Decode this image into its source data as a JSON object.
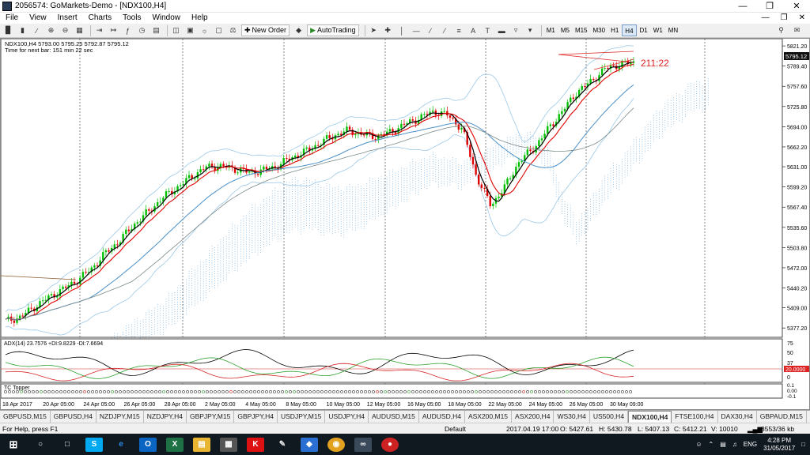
{
  "window": {
    "title": "2056574: GoMarkets-Demo - [NDX100,H4]"
  },
  "menu": [
    "File",
    "View",
    "Insert",
    "Charts",
    "Tools",
    "Window",
    "Help"
  ],
  "toolbar": {
    "new_order": "New Order",
    "auto_trading": "AutoTrading",
    "timeframes": [
      "M1",
      "M5",
      "M15",
      "M30",
      "H1",
      "H4",
      "D1",
      "W1",
      "MN"
    ],
    "selected_timeframe": "H4"
  },
  "chart": {
    "symbol_info": "NDX100,H4  5793.00 5795.25 5792.87 5795.12",
    "timer": "Time for next bar: 151 min 22 sec",
    "countdown_label": "211:22",
    "current_price": "5795.12",
    "price_ticks": [
      "5821.20",
      "5789.40",
      "5757.60",
      "5725.80",
      "5694.00",
      "5662.20",
      "5631.00",
      "5599.20",
      "5567.40",
      "5535.60",
      "5503.80",
      "5472.00",
      "5440.20",
      "5409.00",
      "5377.20"
    ],
    "time_labels": [
      "18 Apr 2017",
      "20 Apr 05:00",
      "24 Apr 05:00",
      "26 Apr 05:00",
      "28 Apr 05:00",
      "2 May 05:00",
      "4 May 05:00",
      "8 May 05:00",
      "10 May 05:00",
      "12 May 05:00",
      "16 May 05:00",
      "18 May 05:00",
      "22 May 05:00",
      "24 May 05:00",
      "26 May 05:00",
      "30 May 09:00"
    ],
    "adx_label": "ADX(14) 23.7576 +DI:9.8229 -DI:7.6694",
    "adx_ticks": [
      "75",
      "50",
      "37",
      "0"
    ],
    "adx_level": "20.0000",
    "tc_label": "TC Topper",
    "tc_ticks": [
      "0.1",
      "0.00",
      "-0.1"
    ]
  },
  "chart_data": {
    "type": "line",
    "title": "NDX100,H4",
    "ylim": [
      5365,
      5830
    ],
    "series": [
      {
        "name": "NDX100",
        "values": [
          5388,
          5394,
          5410,
          5425,
          5438,
          5452,
          5470,
          5495,
          5515,
          5540,
          5560,
          5582,
          5598,
          5615,
          5630,
          5632,
          5628,
          5622,
          5625,
          5632,
          5645,
          5655,
          5668,
          5680,
          5688,
          5682,
          5678,
          5686,
          5698,
          5708,
          5718,
          5712,
          5690,
          5615,
          5570,
          5600,
          5640,
          5660,
          5690,
          5718,
          5748,
          5765,
          5785,
          5792,
          5795
        ]
      }
    ]
  },
  "tabs": [
    "GBPUSD,M15",
    "GBPUSD,H4",
    "NZDJPY,M15",
    "NZDJPY,H4",
    "GBPJPY,M15",
    "GBPJPY,H4",
    "USDJPY,M15",
    "USDJPY,H4",
    "AUDUSD,M15",
    "AUDUSD,H4",
    "ASX200,M15",
    "ASX200,H4",
    "WS30,H4",
    "US500,H4",
    "NDX100,H4",
    "FTSE100,H4",
    "DAX30,H4",
    "GBPAUD,M15"
  ],
  "active_tab": "NDX100,H4",
  "status": {
    "help": "For Help, press F1",
    "profile": "Default",
    "datetime": "2017.04.19 17:00",
    "open": "O: 5427.61",
    "high": "H: 5430.78",
    "low": "L: 5407.13",
    "close": "C: 5412.21",
    "volume": "V: 10010",
    "connection": "8553/36 kb"
  },
  "taskbar": {
    "lang": "ENG",
    "time": "4:28 PM",
    "date": "31/05/2017"
  },
  "colors": {
    "up": "#00c000",
    "down": "#e00000",
    "cloud": "#5aa0d8",
    "cloud_bear": "#d040c0",
    "band": "#9cc8e8"
  }
}
